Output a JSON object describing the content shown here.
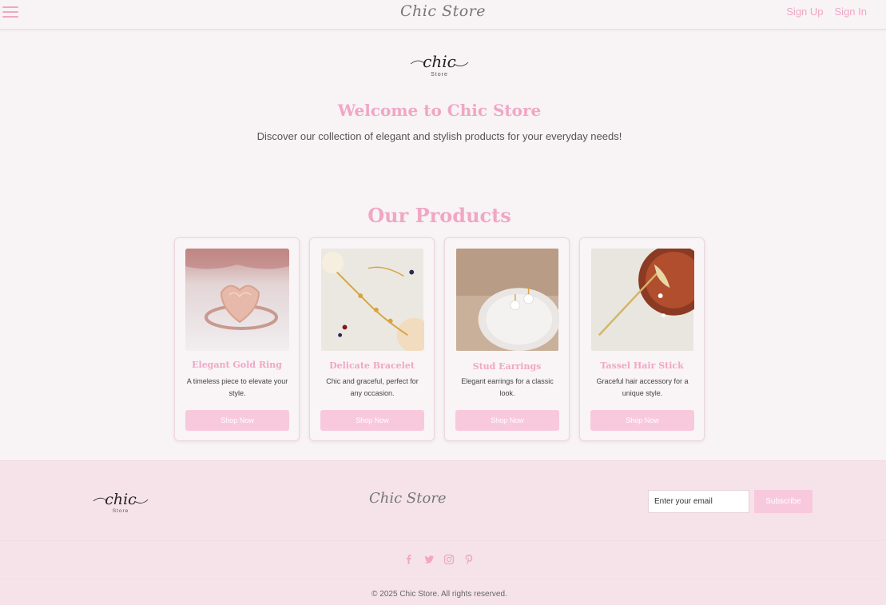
{
  "nav": {
    "brand": "Chic Store",
    "signup": "Sign Up",
    "signin": "Sign In"
  },
  "hero": {
    "title": "Welcome to Chic Store",
    "subtitle": "Discover our collection of elegant and stylish products for your everyday needs!"
  },
  "products": {
    "title": "Our Products",
    "items": [
      {
        "name": "Elegant Gold Ring",
        "desc": "A timeless piece to elevate your style.",
        "button": "Shop Now"
      },
      {
        "name": "Delicate Bracelet",
        "desc": "Chic and graceful, perfect for any occasion.",
        "button": "Shop Now"
      },
      {
        "name": "Stud Earrings",
        "desc": "Elegant earrings for a classic look.",
        "button": "Shop Now"
      },
      {
        "name": "Tassel Hair Stick",
        "desc": "Graceful hair accessory for a unique style.",
        "button": "Shop Now"
      }
    ]
  },
  "footer": {
    "brand": "Chic Store",
    "email_placeholder": "Enter your email",
    "subscribe": "Subscribe",
    "socials": [
      "facebook-icon",
      "twitter-icon",
      "instagram-icon",
      "pinterest-icon"
    ],
    "copyright": "© 2025 Chic Store. All rights reserved."
  },
  "logo": {
    "word": "chic",
    "sub": "Store"
  },
  "colors": {
    "accent": "#f0a7c4",
    "button": "#f8c9dc",
    "footer_bg": "#f6e3ea",
    "page_bg": "#f8f3f5"
  }
}
